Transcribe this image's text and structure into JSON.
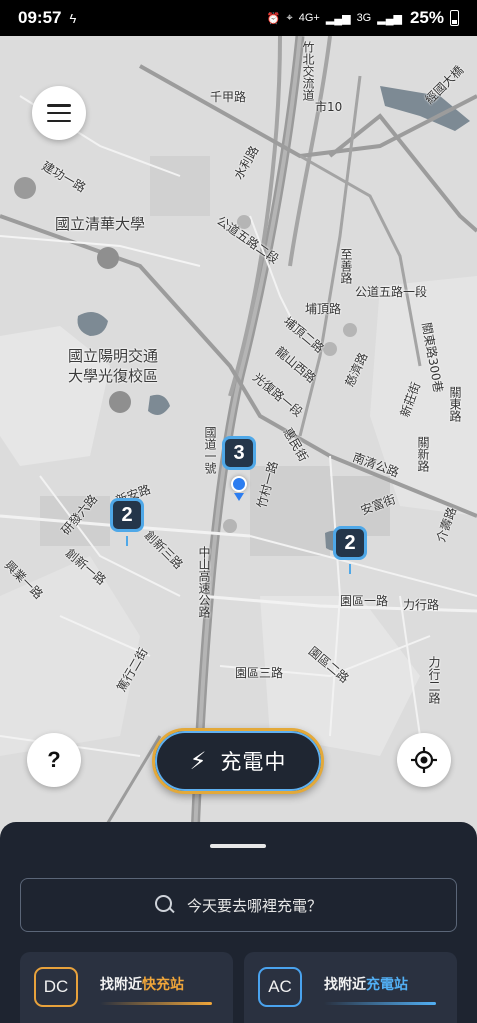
{
  "status": {
    "time": "09:57",
    "network_a": "4G+",
    "network_b": "3G",
    "battery": "25%"
  },
  "map": {
    "labels": {
      "qianjia": "千甲路",
      "city10": "市10",
      "zhubei": "竹北交流道",
      "jingguo": "經國大橋",
      "jiangong": "建功一路",
      "shuili": "水利路",
      "tsinghua": "國立清華大學",
      "gongdao2": "公道五路二段",
      "zhixue": "至善路",
      "gongdao5": "公道五路一段",
      "puding": "埔頂路",
      "puding2": "埔頂二路",
      "longshan": "龍山西路",
      "guanxin": "關東路300巷",
      "yangming": "國立陽明交通\n大學光復校區",
      "ciji": "慈濟路",
      "xingcheng": "新莊街",
      "guangfu": "光復路一段",
      "guandong": "關東路",
      "guanxinst": "關新路",
      "huiming": "惠民街",
      "nanqing": "南清公路",
      "zhucun": "竹村一路",
      "national1": "國道一號",
      "xinan": "新安路",
      "yanxin": "研發六路",
      "anfu": "安富街",
      "jieshou": "介壽路",
      "chuangxin3": "創新三路",
      "chuangxin1": "創新一路",
      "xingye": "興業一路",
      "zhongshan": "中山高速公路",
      "yuanqu1": "園區一路",
      "lixing": "力行路",
      "lixing2": "力行二路",
      "yuanqu2": "園區二路",
      "yuanqu3": "園區三路",
      "industry2": "篤行二街"
    },
    "clusters": [
      {
        "count": "3"
      },
      {
        "count": "2"
      },
      {
        "count": "2"
      }
    ]
  },
  "buttons": {
    "menu_icon": "menu-icon",
    "help_label": "?",
    "charging_label": "充電中",
    "locate_icon": "crosshair-icon"
  },
  "sheet": {
    "search_placeholder": "今天要去哪裡充電？",
    "dc": {
      "badge": "DC",
      "prefix": "找附近",
      "highlight": "快充站"
    },
    "ac": {
      "badge": "AC",
      "prefix": "找附近",
      "highlight": "充電站"
    }
  },
  "colors": {
    "dc_accent": "#f0a63a",
    "ac_accent": "#52b0f5",
    "sheet_bg": "#1e2430"
  }
}
